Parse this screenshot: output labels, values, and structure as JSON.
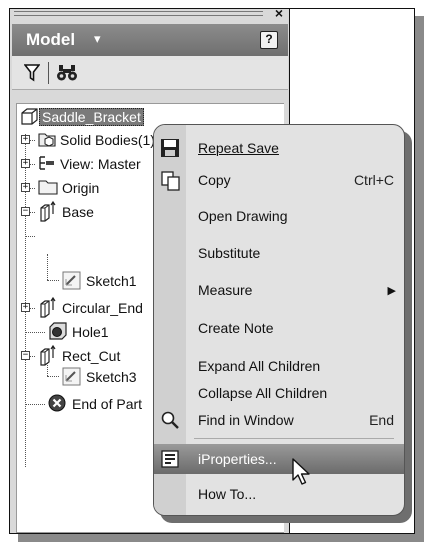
{
  "panel": {
    "title": "Model",
    "caret": "▾",
    "help_label": "?",
    "close_label": "×"
  },
  "tree": [
    {
      "id": "saddle",
      "label": "Saddle_Bracket",
      "icon": "part-icon"
    },
    {
      "id": "solid",
      "label": "Solid Bodies(1)",
      "icon": "solid-bodies-icon"
    },
    {
      "id": "view",
      "label": "View: Master",
      "icon": "view-icon"
    },
    {
      "id": "origin",
      "label": "Origin",
      "icon": "folder-icon"
    },
    {
      "id": "base",
      "label": "Base",
      "icon": "extrusion-icon"
    },
    {
      "id": "sketch1",
      "label": "Sketch1",
      "icon": "sketch-icon"
    },
    {
      "id": "circular",
      "label": "Circular_End",
      "icon": "extrusion-icon"
    },
    {
      "id": "hole1",
      "label": "Hole1",
      "icon": "hole-icon"
    },
    {
      "id": "rect",
      "label": "Rect_Cut",
      "icon": "extrusion-icon"
    },
    {
      "id": "sketch3",
      "label": "Sketch3",
      "icon": "sketch-icon"
    },
    {
      "id": "eop",
      "label": "End of Part",
      "icon": "end-of-part-icon"
    }
  ],
  "menu": {
    "repeat_save": "Repeat Save",
    "copy": "Copy",
    "copy_shortcut": "Ctrl+C",
    "open_drawing": "Open Drawing",
    "substitute": "Substitute",
    "measure": "Measure",
    "measure_arrow": "▶",
    "create_note": "Create Note",
    "expand_all": "Expand All Children",
    "collapse_all": "Collapse All Children",
    "find_in_window": "Find in Window",
    "find_shortcut": "End",
    "iproperties": "iProperties...",
    "how_to": "How To..."
  },
  "highlighted_item": "iproperties"
}
